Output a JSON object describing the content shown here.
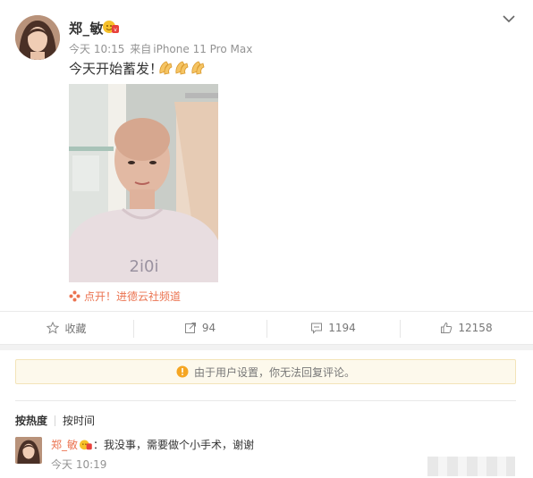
{
  "post": {
    "author": "郑_敏",
    "time": "今天 10:15",
    "source_prefix": "来自",
    "device": "iPhone 11 Pro Max",
    "text": "今天开始蓄发！",
    "source_link": "点开！进德云社频道"
  },
  "actions": {
    "favorite": "收藏",
    "repost": "94",
    "comment": "1194",
    "like": "12158"
  },
  "notice": "由于用户设置，你无法回复评论。",
  "sort": {
    "hot": "按热度",
    "time": "按时间"
  },
  "comment": {
    "author": "郑_敏",
    "text": "：我没事，需要做个小手术，谢谢",
    "time": "今天 10:19"
  },
  "colors": {
    "link": "#eb7350",
    "notice_bg": "#fdf9ec",
    "warn": "#f5a623"
  },
  "icons": [
    "chevron-down-icon",
    "vip-badge-icon",
    "clap-icon",
    "flower-icon",
    "star-icon",
    "repost-icon",
    "comment-icon",
    "like-icon",
    "warning-icon"
  ]
}
